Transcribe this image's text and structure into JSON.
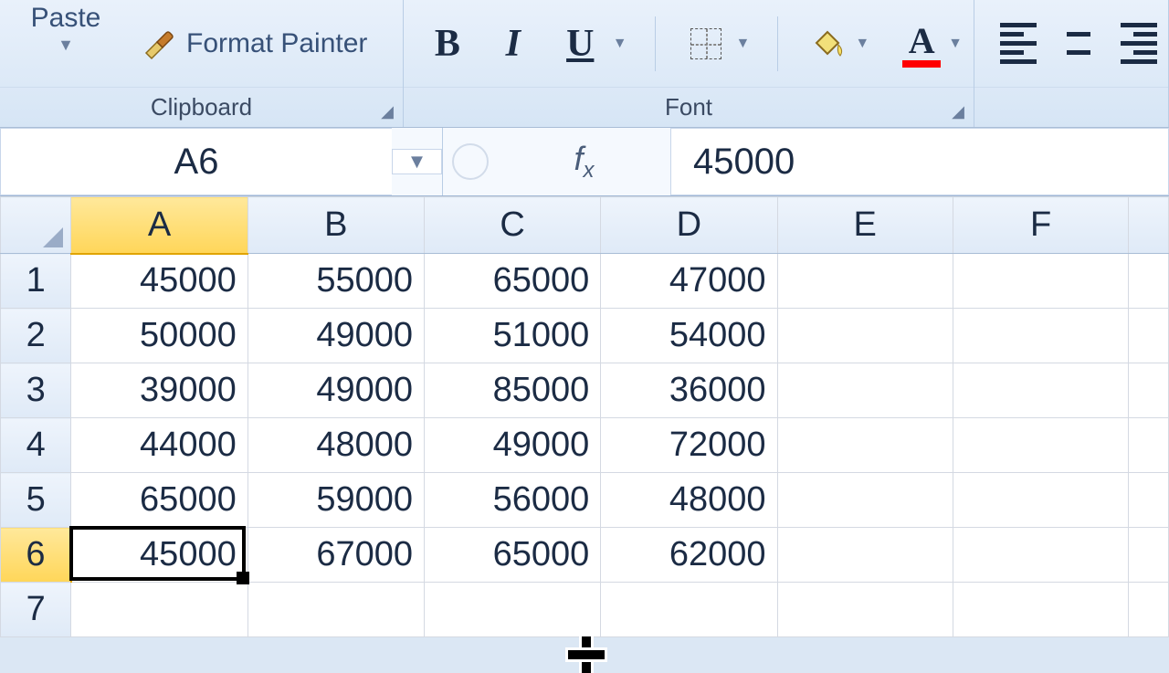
{
  "ribbon": {
    "clipboard": {
      "label": "Clipboard",
      "paste": "Paste",
      "format_painter": "Format Painter"
    },
    "font": {
      "label": "Font",
      "bold": "B",
      "italic": "I",
      "underline": "U"
    }
  },
  "namebox": "A6",
  "formula_value": "45000",
  "columns": [
    "A",
    "B",
    "C",
    "D",
    "E",
    "F"
  ],
  "rows": [
    "1",
    "2",
    "3",
    "4",
    "5",
    "6",
    "7"
  ],
  "selected_col": 0,
  "selected_row": 5,
  "cells": [
    [
      "45000",
      "55000",
      "65000",
      "47000",
      "",
      ""
    ],
    [
      "50000",
      "49000",
      "51000",
      "54000",
      "",
      ""
    ],
    [
      "39000",
      "49000",
      "85000",
      "36000",
      "",
      ""
    ],
    [
      "44000",
      "48000",
      "49000",
      "72000",
      "",
      ""
    ],
    [
      "65000",
      "59000",
      "56000",
      "48000",
      "",
      ""
    ],
    [
      "45000",
      "67000",
      "65000",
      "62000",
      "",
      ""
    ],
    [
      "",
      "",
      "",
      "",
      "",
      ""
    ]
  ],
  "chart_data": {
    "type": "table",
    "columns": [
      "A",
      "B",
      "C",
      "D"
    ],
    "rows": [
      [
        45000,
        55000,
        65000,
        47000
      ],
      [
        50000,
        49000,
        51000,
        54000
      ],
      [
        39000,
        49000,
        85000,
        36000
      ],
      [
        44000,
        48000,
        49000,
        72000
      ],
      [
        65000,
        59000,
        56000,
        48000
      ],
      [
        45000,
        67000,
        65000,
        62000
      ]
    ]
  }
}
